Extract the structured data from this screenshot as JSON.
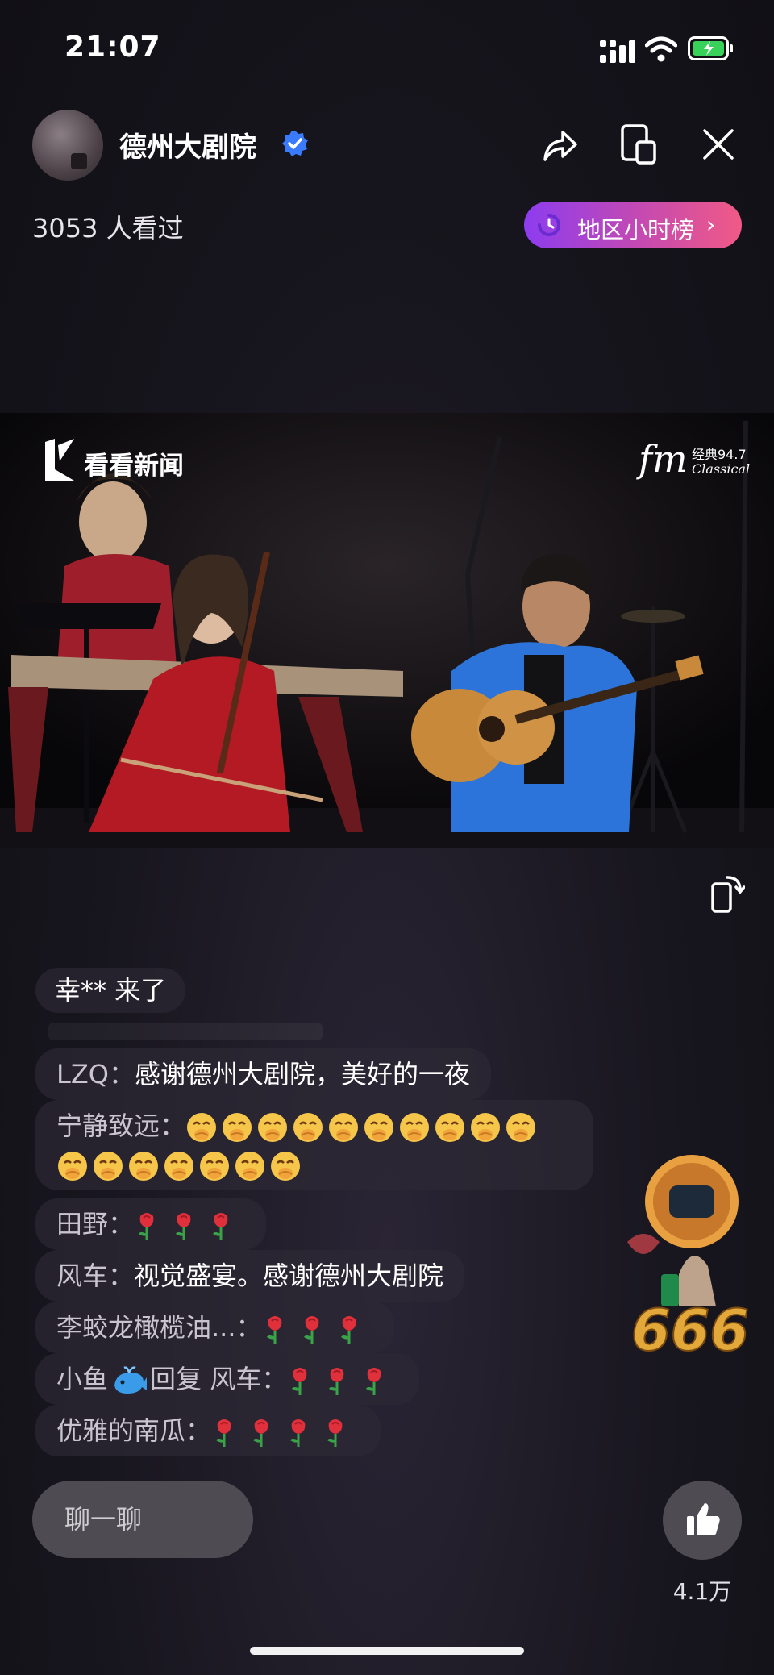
{
  "status_bar": {
    "time": "21:07"
  },
  "header": {
    "channel_name": "德州大剧院",
    "viewers": "3053 人看过",
    "rank_label": "地区小时榜",
    "rank_chevron": "›"
  },
  "video": {
    "watermark_left": "看看新闻",
    "watermark_right_fm": "fm",
    "watermark_right_freq": "经典94.7",
    "watermark_right_sub": "Classical"
  },
  "chat": {
    "join_notice": "幸** 来了",
    "messages": [
      {
        "user": "LZQ",
        "text": "感谢德州大剧院，美好的一夜"
      },
      {
        "user": "宁静致远",
        "emoji": "shushing-face",
        "emoji_count": 17
      },
      {
        "user": "田野",
        "emoji": "rose",
        "emoji_count": 3
      },
      {
        "user": "风车",
        "text": "视觉盛宴。感谢德州大剧院"
      },
      {
        "user": "李蛟龙橄榄油...",
        "emoji": "rose",
        "emoji_count": 3
      },
      {
        "user": "小鱼",
        "reply_word": "回复",
        "reply_to": "风车",
        "emoji": "rose",
        "emoji_count": 3
      },
      {
        "user": "优雅的南瓜",
        "emoji": "rose",
        "emoji_count": 4
      }
    ],
    "colon": "："
  },
  "gift": {
    "label": "666"
  },
  "bottom": {
    "chat_placeholder": "聊一聊",
    "like_count": "4.1万"
  },
  "colors": {
    "background": "#14121a",
    "rank_gradient_start": "#8d3cf0",
    "rank_gradient_end": "#f05a86",
    "verified_blue": "#3a7bfd"
  },
  "icons": [
    "signal-icon",
    "wifi-icon",
    "battery-icon",
    "verified-icon",
    "share-icon",
    "pip-icon",
    "close-icon",
    "rank-clock-icon",
    "rotate-screen-icon",
    "thumbs-up-icon",
    "whale-icon"
  ]
}
